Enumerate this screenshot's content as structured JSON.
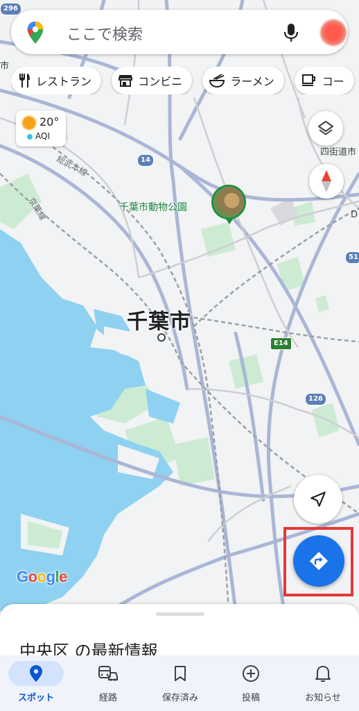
{
  "search": {
    "placeholder": "ここで検索"
  },
  "chips": [
    {
      "label": "レストラン",
      "icon": "fork-knife-icon"
    },
    {
      "label": "コンビニ",
      "icon": "store-icon"
    },
    {
      "label": "ラーメン",
      "icon": "ramen-icon"
    },
    {
      "label": "コー",
      "icon": "coffee-icon"
    }
  ],
  "weather": {
    "temp": "20°",
    "aqi_label": "AQI"
  },
  "map": {
    "city": "千葉市",
    "poi": "千葉市動物公園",
    "rail_1": "総武本線",
    "rail_2": "京葉線",
    "edge_1": "市",
    "edge_2": "四街道市",
    "edge_3": "D",
    "shields": {
      "r296": "296",
      "r14": "14",
      "r51": "51",
      "e14": "E14",
      "r126": "126"
    },
    "google": [
      "G",
      "o",
      "o",
      "g",
      "l",
      "e"
    ],
    "google_colors": [
      "#4285F4",
      "#EA4335",
      "#FBBC05",
      "#4285F4",
      "#34A853",
      "#EA4335"
    ]
  },
  "sheet": {
    "title": "中央区 の最新情報"
  },
  "nav": [
    {
      "label": "スポット",
      "icon": "location-pin-icon",
      "active": true
    },
    {
      "label": "経路",
      "icon": "commute-icon",
      "active": false
    },
    {
      "label": "保存済み",
      "icon": "bookmark-icon",
      "active": false
    },
    {
      "label": "投稿",
      "icon": "add-circle-icon",
      "active": false
    },
    {
      "label": "お知らせ",
      "icon": "bell-icon",
      "active": false
    }
  ],
  "colors": {
    "accent": "#1a73e8",
    "water": "#8fd1f0",
    "park": "#cdebd3",
    "highlight": "#e53935"
  }
}
